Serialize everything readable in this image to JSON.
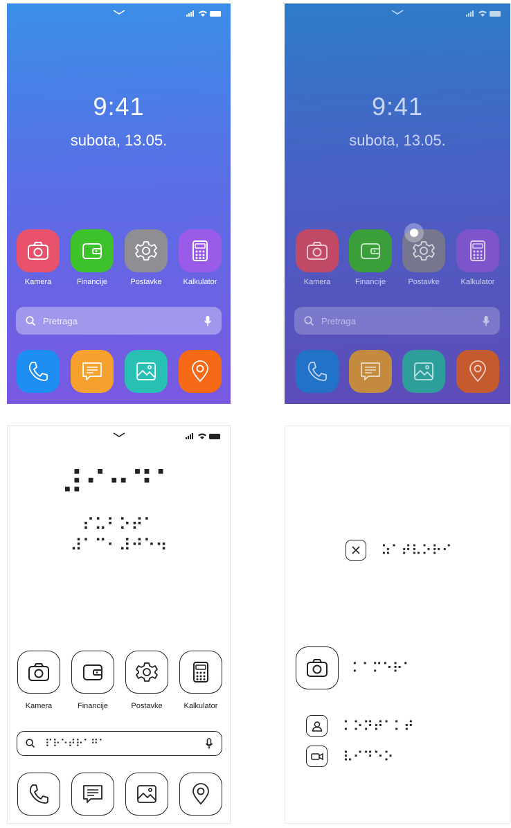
{
  "colors": {
    "kamera": "#e8536b",
    "financije": "#3ec22c",
    "postavke": "#8e8e93",
    "kalkulator": "#9a5be8",
    "phone": "#1e8ff2",
    "messages": "#f6a02d",
    "gallery": "#27c0b2",
    "maps": "#f66a17"
  },
  "lock": {
    "time": "9:41",
    "date": "subota, 13.05."
  },
  "apps": [
    {
      "label": "Kamera",
      "icon": "camera-icon"
    },
    {
      "label": "Financije",
      "icon": "wallet-icon"
    },
    {
      "label": "Postavke",
      "icon": "gear-icon"
    },
    {
      "label": "Kalkulator",
      "icon": "calculator-icon"
    }
  ],
  "dock": [
    {
      "icon": "phone-icon"
    },
    {
      "icon": "message-icon"
    },
    {
      "icon": "image-icon"
    },
    {
      "icon": "location-icon"
    }
  ],
  "search": {
    "placeholder": "Pretraga"
  },
  "braille": {
    "time": "⠼⠊⠒⠙⠁",
    "date_line1": "⠎⠥⠃⠕⠞⠁",
    "date_line2": "⠼⠁⠉⠂⠼⠚⠑⠲",
    "search": "⠏⠗⠑⠞⠗⠁⠛⠁",
    "close": "⠵⠁⠞⠧⠕⠗⠊",
    "camera": "⠅⠁⠍⠑⠗⠁",
    "contact": "⠅⠕⠝⠞⠁⠅⠞",
    "video": "⠧⠊⠙⠑⠕"
  }
}
